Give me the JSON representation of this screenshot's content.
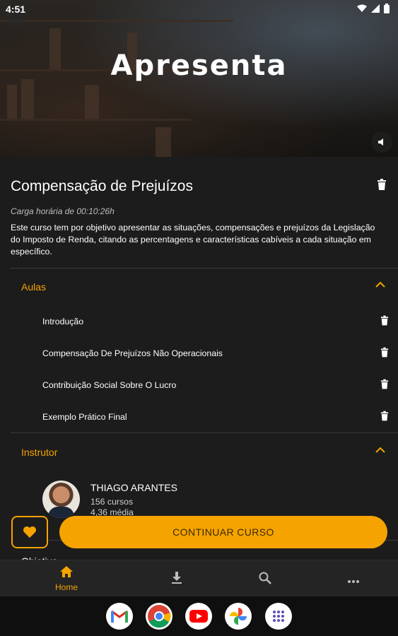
{
  "status_bar": {
    "time": "4:51"
  },
  "hero": {
    "title": "Apresenta"
  },
  "course": {
    "title": "Compensação de Prejuízos",
    "workload": "Carga horária de 00:10:26h",
    "description": "Este curso tem por objetivo apresentar as situações, compensações e prejuízos da Legislação do Imposto de Renda, citando as percentagens e características cabíveis a cada situação em específico."
  },
  "lessons_section": {
    "label": "Aulas",
    "items": [
      {
        "label": "Introdução"
      },
      {
        "label": "Compensação De Prejuízos Não Operacionais"
      },
      {
        "label": "Contribuição Social Sobre O Lucro"
      },
      {
        "label": "Exemplo Prático Final"
      }
    ]
  },
  "instructor_section": {
    "label": "Instrutor",
    "name": "THIAGO ARANTES",
    "courses": "156 cursos",
    "rating": "4,36 média"
  },
  "objective_section": {
    "label": "Objetivo"
  },
  "actions": {
    "continue_label": "CONTINUAR CURSO"
  },
  "bottom_nav": {
    "home_label": "Home"
  },
  "colors": {
    "accent": "#f5a300",
    "background": "#1c1c1c",
    "nav_background": "#242424"
  }
}
